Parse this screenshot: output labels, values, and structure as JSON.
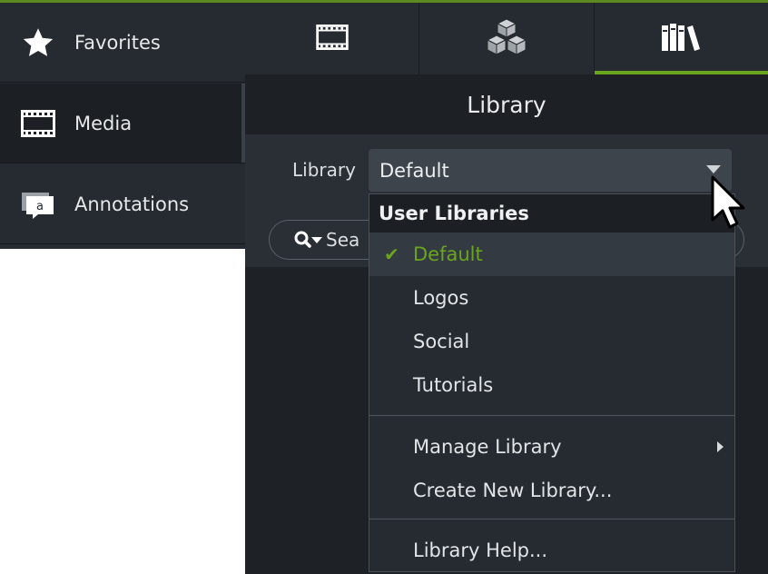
{
  "sidebar": {
    "items": [
      {
        "label": "Favorites",
        "icon": "star-icon"
      },
      {
        "label": "Media",
        "icon": "film-strip-icon"
      },
      {
        "label": "Annotations",
        "icon": "callout-icon"
      }
    ]
  },
  "tabs": [
    {
      "icon": "film-strip-icon"
    },
    {
      "icon": "cubes-icon"
    },
    {
      "icon": "books-icon"
    }
  ],
  "panel": {
    "title": "Library",
    "library_label": "Library",
    "library_value": "Default",
    "search_text": "Sea"
  },
  "menu": {
    "header": "User Libraries",
    "items": [
      "Default",
      "Logos",
      "Social",
      "Tutorials"
    ],
    "manage": "Manage Library",
    "create": "Create New Library...",
    "help": "Library Help..."
  },
  "colors": {
    "accent": "#6aa51e",
    "background": "#1d2126",
    "sidebar": "#262b31"
  }
}
